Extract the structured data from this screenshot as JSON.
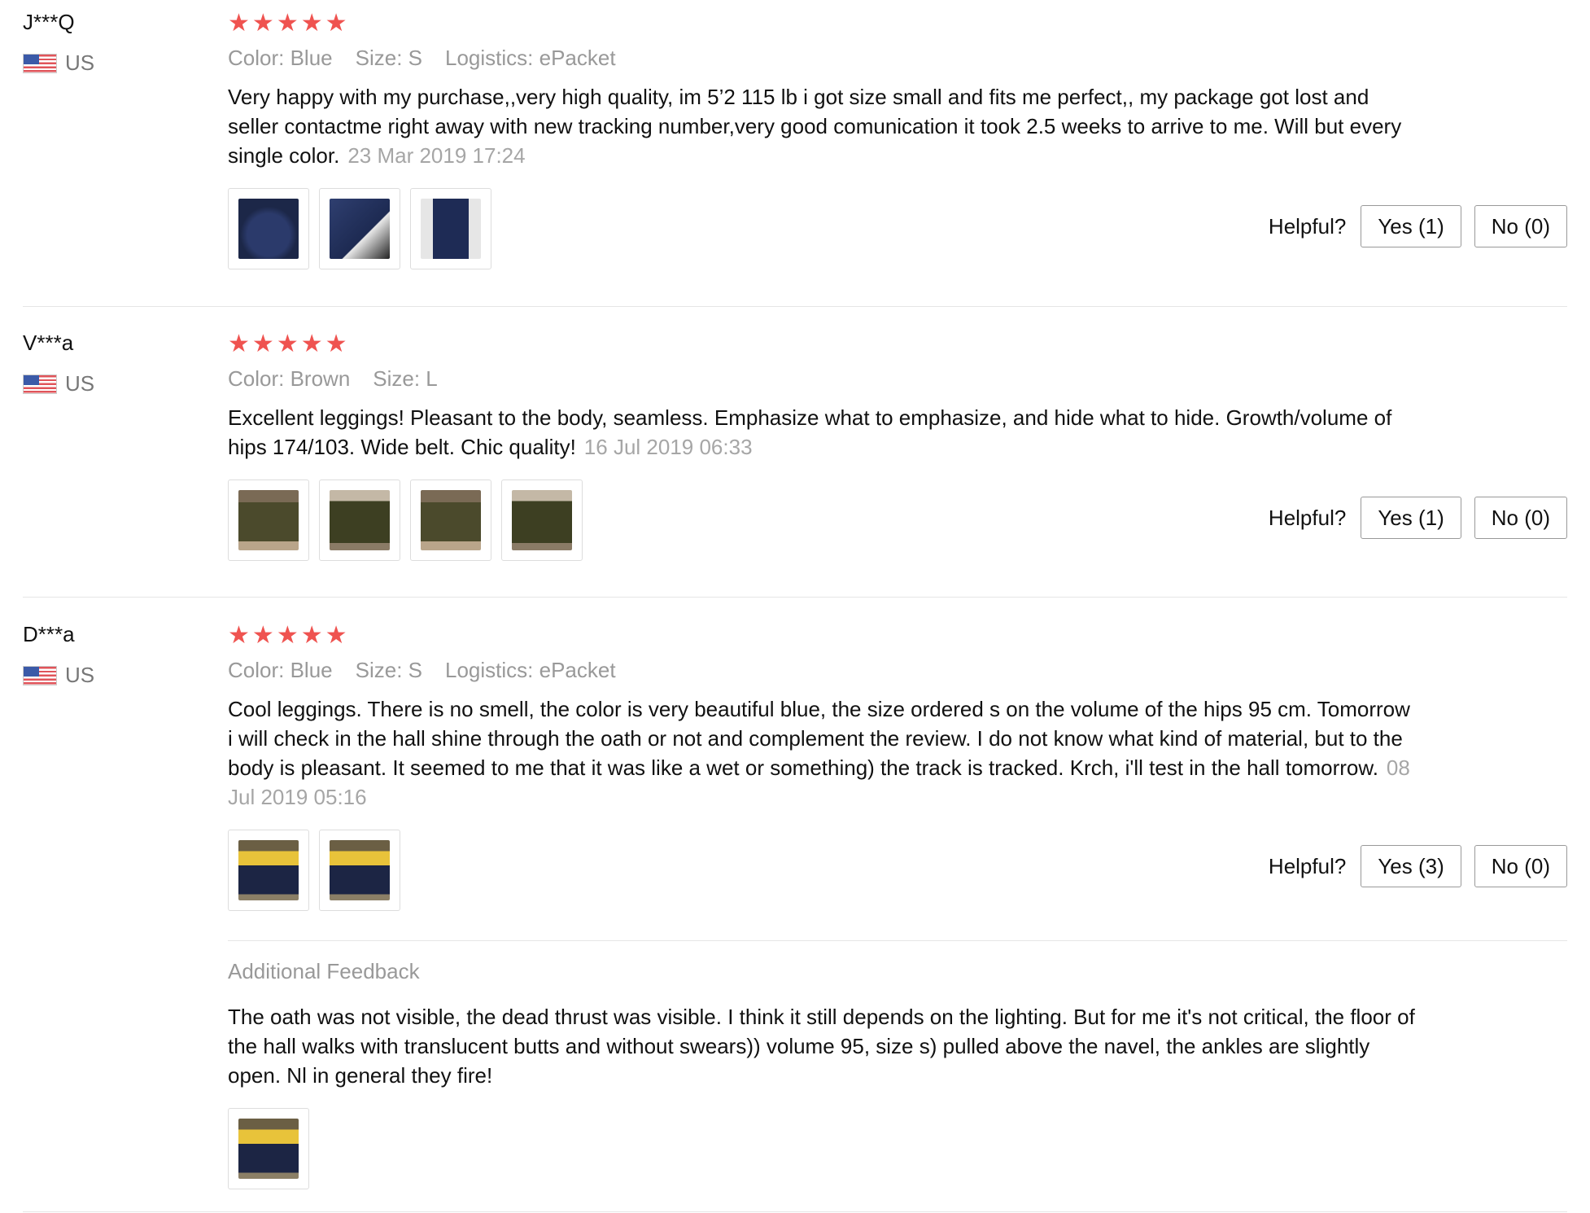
{
  "reviews": [
    {
      "user": "J***Q",
      "country": "US",
      "stars": 5,
      "meta": [
        "Color: Blue",
        "Size: S",
        "Logistics: ePacket"
      ],
      "text": "Very happy with my purchase,,very high quality, im 5’2 115 lb i got size small and fits me perfect,, my package got lost and seller contactme right away with new tracking number,very good comunication it took 2.5 weeks to arrive to me. Will but every single color.",
      "date": "23 Mar 2019 17:24",
      "photos": 3,
      "helpful_label": "Helpful?",
      "yes_label": "Yes (1)",
      "no_label": "No (0)"
    },
    {
      "user": "V***a",
      "country": "US",
      "stars": 5,
      "meta": [
        "Color: Brown",
        "Size: L"
      ],
      "text": "Excellent leggings! Pleasant to the body, seamless. Emphasize what to emphasize, and hide what to hide. Growth/volume of hips 174/103. Wide belt. Chic quality!",
      "date": "16 Jul 2019 06:33",
      "photos": 4,
      "helpful_label": "Helpful?",
      "yes_label": "Yes (1)",
      "no_label": "No (0)"
    },
    {
      "user": "D***a",
      "country": "US",
      "stars": 5,
      "meta": [
        "Color: Blue",
        "Size: S",
        "Logistics: ePacket"
      ],
      "text": "Cool leggings. There is no smell, the color is very beautiful blue, the size ordered s on the volume of the hips 95 cm. Tomorrow i will check in the hall shine through the oath or not and complement the review. I do not know what kind of material, but to the body is pleasant. It seemed to me that it was like a wet or something) the track is tracked. Krch, i'll test in the hall tomorrow.",
      "date": "08 Jul 2019 05:16",
      "photos": 2,
      "helpful_label": "Helpful?",
      "yes_label": "Yes (3)",
      "no_label": "No (0)",
      "additional": {
        "title": "Additional Feedback",
        "text": "The oath was not visible, the dead thrust was visible. I think it still depends on the lighting. But for me it's not critical, the floor of the hall walks with translucent butts and without swears)) volume 95, size s) pulled above the navel, the ankles are slightly open. Nl in general they fire!",
        "photos": 1
      }
    }
  ],
  "colors": {
    "star": "#ef5350",
    "meta": "#999999",
    "date": "#a6a6a6"
  },
  "icons": {
    "star": "star-icon",
    "flag": "us-flag-icon"
  }
}
